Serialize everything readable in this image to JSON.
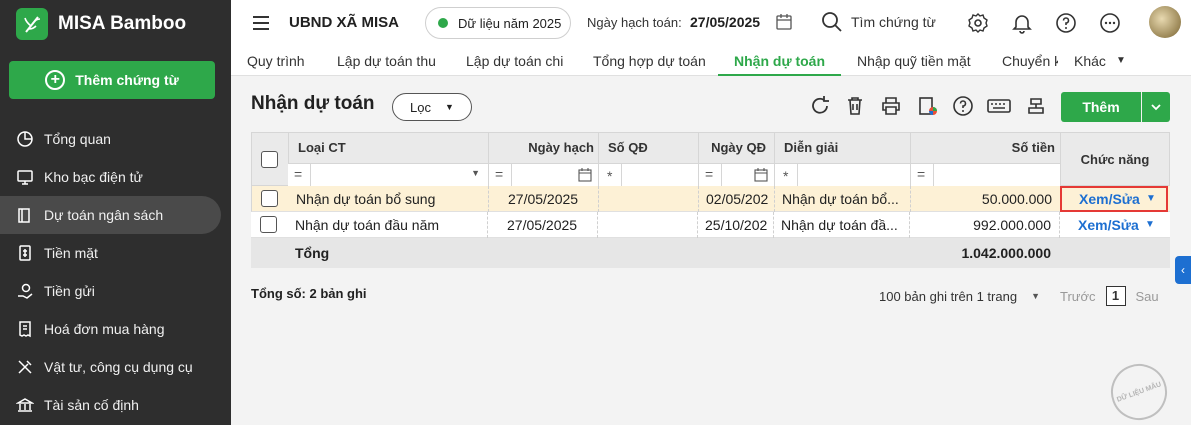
{
  "brand": {
    "name": "MISA Bamboo",
    "add_voucher_label": "Thêm chứng từ"
  },
  "sidebar": {
    "items": [
      {
        "label": "Tổng quan",
        "icon": "pie-chart-icon"
      },
      {
        "label": "Kho bạc điện tử",
        "icon": "monitor-icon"
      },
      {
        "label": "Dự toán ngân sách",
        "icon": "book-icon",
        "active": true
      },
      {
        "label": "Tiền mặt",
        "icon": "money-icon"
      },
      {
        "label": "Tiền gửi",
        "icon": "hand-coin-icon"
      },
      {
        "label": "Hoá đơn mua hàng",
        "icon": "invoice-icon"
      },
      {
        "label": "Vật tư, công cụ dụng cụ",
        "icon": "tools-icon"
      },
      {
        "label": "Tài sản cố định",
        "icon": "building-icon"
      }
    ]
  },
  "header": {
    "org": "UBND XÃ MISA",
    "data_year": "Dữ liệu năm 2025",
    "posting_date_label": "Ngày hạch toán:",
    "posting_date": "27/05/2025",
    "search_label": "Tìm chứng từ"
  },
  "tabs": [
    {
      "label": "Quy trình"
    },
    {
      "label": "Lập dự toán thu"
    },
    {
      "label": "Lập dự toán chi"
    },
    {
      "label": "Tổng hợp dự toán"
    },
    {
      "label": "Nhận dự toán",
      "active": true
    },
    {
      "label": "Nhập quỹ tiền mặt"
    },
    {
      "label": "Chuyển k"
    },
    {
      "label": "Khác"
    }
  ],
  "page": {
    "title": "Nhận dự toán",
    "filter_label": "Lọc",
    "add_label": "Thêm"
  },
  "table": {
    "columns": {
      "type": "Loại CT",
      "posting_date": "Ngày hạch toán",
      "decision_no": "Số QĐ",
      "decision_date": "Ngày QĐ",
      "description": "Diễn giải",
      "amount": "Số tiền",
      "actions": "Chức năng"
    },
    "filter_ops": {
      "type": "=",
      "posting_date": "=",
      "decision_no": "*",
      "decision_date": "=",
      "description": "*",
      "amount": "="
    },
    "rows": [
      {
        "type": "Nhận dự toán bổ sung",
        "posting_date": "27/05/2025",
        "decision_no": "",
        "decision_date": "02/05/202",
        "description": "Nhận dự toán bổ...",
        "amount": "50.000.000",
        "action": "Xem/Sửa"
      },
      {
        "type": "Nhận dự toán đầu năm",
        "posting_date": "27/05/2025",
        "decision_no": "",
        "decision_date": "25/10/202",
        "description": "Nhận dự toán đầ...",
        "amount": "992.000.000",
        "action": "Xem/Sửa"
      }
    ],
    "total_label": "Tổng",
    "total_amount": "1.042.000.000"
  },
  "footer": {
    "total_records": "Tổng số: 2 bản ghi",
    "per_page": "100 bản ghi trên 1 trang",
    "prev": "Trước",
    "page": "1",
    "next": "Sau"
  },
  "watermark": "DỮ LIỆU MẪU",
  "colors": {
    "brand_green": "#2ea84a",
    "sidebar_bg": "#2e2e2e",
    "link_blue": "#1d6fd1",
    "highlight_red": "#e53935",
    "selected_row": "#fdf1d6"
  }
}
